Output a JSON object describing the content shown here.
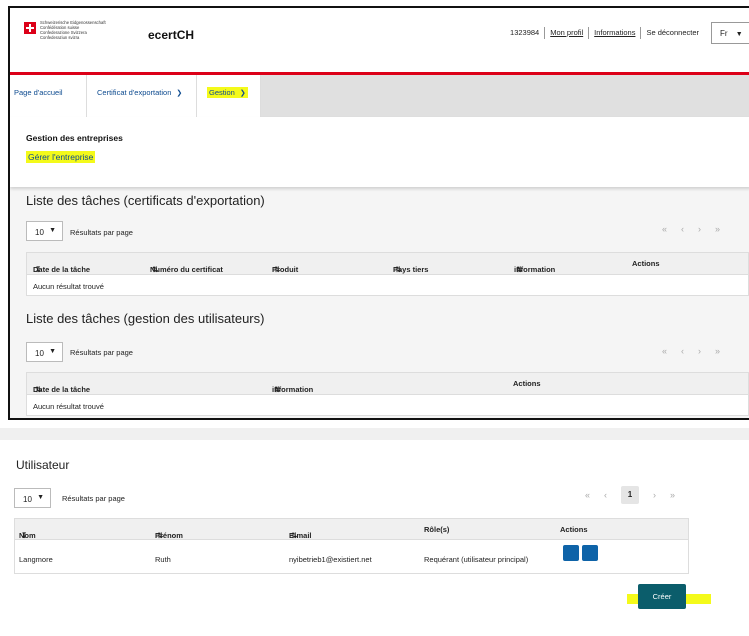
{
  "header": {
    "logo_lines": [
      "Schweizerische Eidgenossenschaft",
      "Confédération suisse",
      "Confederazione Svizzera",
      "Confederaziun svizra"
    ],
    "brand": "ecertCH",
    "user_id": "1323984",
    "profile_link": "Mon profil",
    "info_link": "Informations",
    "logout_link": "Se déconnecter",
    "language": "Fr"
  },
  "nav": {
    "home": "Page d'accueil",
    "export_cert": "Certificat d'exportation",
    "management": "Gestion"
  },
  "submenu": {
    "title": "Gestion des entreprises",
    "link": "Gérer l'entreprise"
  },
  "tasks_export": {
    "title": "Liste des tâches (certificats d'exportation)",
    "per_page_value": "10",
    "per_page_label": "Résultats par page",
    "columns": [
      "Date de la tâche",
      "Numéro du certificat",
      "Produit",
      "Pays tiers",
      "information",
      "Actions"
    ],
    "empty": "Aucun résultat trouvé"
  },
  "tasks_users": {
    "title": "Liste des tâches (gestion des utilisateurs)",
    "per_page_value": "10",
    "per_page_label": "Résultats par page",
    "columns": [
      "Date de la tâche",
      "information",
      "Actions"
    ],
    "empty": "Aucun résultat trouvé"
  },
  "pager": {
    "first": "«",
    "prev": "‹",
    "next": "›",
    "last": "»",
    "current_page": "1"
  },
  "users": {
    "title": "Utilisateur",
    "per_page_value": "10",
    "per_page_label": "Résultats par page",
    "columns": [
      "Nom",
      "Prénom",
      "E-mail",
      "Rôle(s)",
      "Actions"
    ],
    "rows": [
      {
        "nom": "Langmore",
        "prenom": "Ruth",
        "email": "nyibetrieb1@existiert.net",
        "role": "Requérant (utilisateur principal)"
      }
    ],
    "create_button": "Créer"
  },
  "colors": {
    "accent_red": "#dc0018",
    "link_blue": "#0c4a8f",
    "highlight": "#f4fa1a",
    "create_button": "#0b5d6b"
  },
  "icons": {
    "edit": "pencil-icon",
    "lock": "lock-icon",
    "sort": "sort-icon",
    "chevron": "chevron-down-icon"
  }
}
